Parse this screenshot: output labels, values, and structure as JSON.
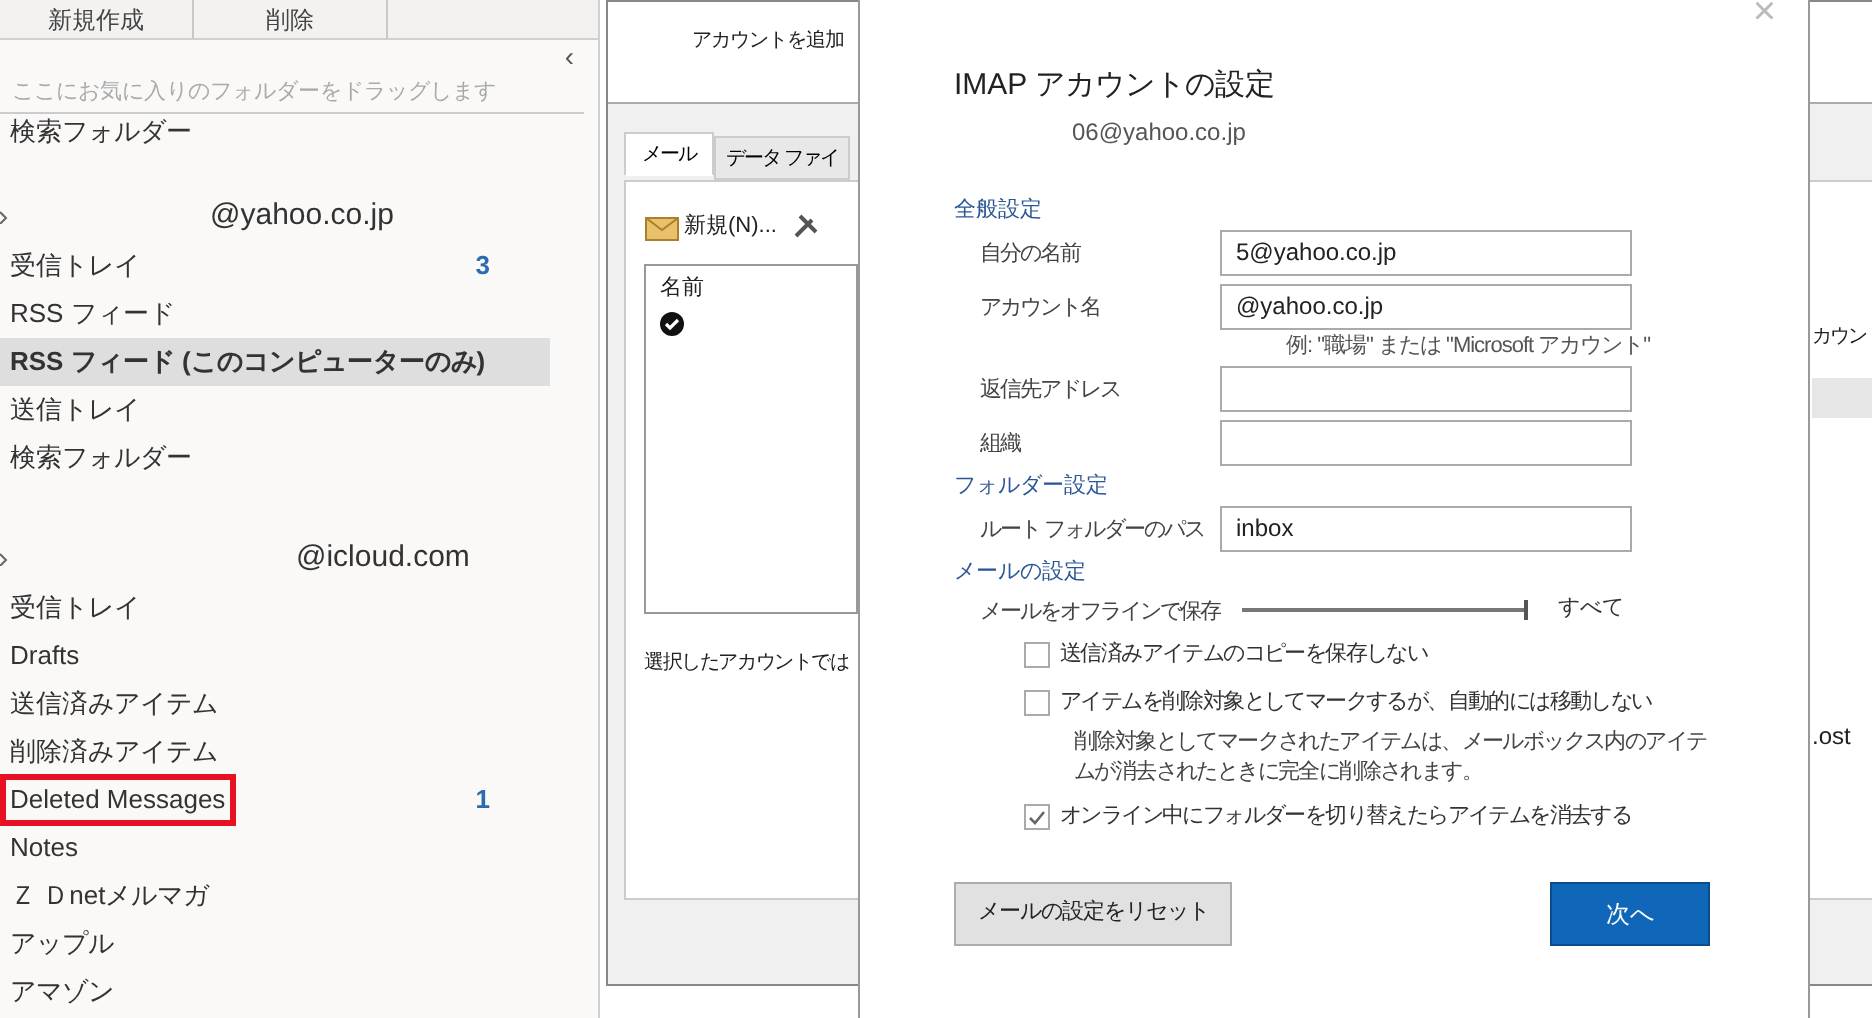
{
  "toolbar": {
    "buttons": [
      "新規作成",
      "削除"
    ]
  },
  "sidebar": {
    "collapse_glyph": "‹",
    "favorites_hint": "ここにお気に入りのフォルダーをドラッグします",
    "top_item": "検索フォルダー",
    "accounts": [
      {
        "name": "@yahoo.co.jp",
        "folders": [
          {
            "label": "受信トレイ",
            "count": "3",
            "selected": false,
            "highlighted": false
          },
          {
            "label": "RSS フィード",
            "selected": false,
            "highlighted": false
          },
          {
            "label": "RSS フィード (このコンピューターのみ)",
            "selected": true,
            "highlighted": false
          },
          {
            "label": "送信トレイ",
            "selected": false,
            "highlighted": false
          },
          {
            "label": "検索フォルダー",
            "selected": false,
            "highlighted": false
          }
        ]
      },
      {
        "name": "@icloud.com",
        "folders": [
          {
            "label": "受信トレイ",
            "selected": false,
            "highlighted": false
          },
          {
            "label": "Drafts",
            "selected": false,
            "highlighted": false
          },
          {
            "label": "送信済みアイテム",
            "selected": false,
            "highlighted": false
          },
          {
            "label": "削除済みアイテム",
            "selected": false,
            "highlighted": false
          },
          {
            "label": "Deleted Messages",
            "count": "1",
            "selected": false,
            "highlighted": true
          },
          {
            "label": "Notes",
            "selected": false,
            "highlighted": false
          },
          {
            "label": "Ｚ Ｄnetメルマガ",
            "selected": false,
            "highlighted": false
          },
          {
            "label": "アップル",
            "selected": false,
            "highlighted": false
          },
          {
            "label": "アマゾン",
            "selected": false,
            "highlighted": false
          }
        ]
      }
    ]
  },
  "account_settings_window": {
    "subtitle": "アカウントを追加",
    "tabs": [
      {
        "label": "メール",
        "selected": true
      },
      {
        "label": "データ ファイ",
        "selected": false
      }
    ],
    "new_button": "新規(N)...",
    "list_header": "名前",
    "note": "選択したアカウントでは",
    "right_texts": [
      "カウン",
      ".ost"
    ]
  },
  "dialog": {
    "close": "×",
    "title": "IMAP アカウントの設定",
    "account": "06@yahoo.co.jp",
    "sections": [
      {
        "heading": "全般設定",
        "fields": [
          {
            "label": "自分の名前",
            "value": "5@yahoo.co.jp"
          },
          {
            "label": "アカウント名",
            "value": "@yahoo.co.jp",
            "hint": "例: \"職場\" または \"Microsoft アカウント\""
          },
          {
            "label": "返信先アドレス"
          },
          {
            "label": "組織"
          }
        ]
      },
      {
        "heading": "フォルダー設定",
        "fields": [
          {
            "label": "ルート フォルダーのパス",
            "value": "inbox"
          }
        ]
      },
      {
        "heading": "メールの設定"
      }
    ],
    "offline": {
      "label": "メールをオフラインで保存",
      "level": 1,
      "reading": "すべて"
    },
    "options": [
      {
        "label": "送信済みアイテムのコピーを保存しない",
        "checked": false
      },
      {
        "label": "アイテムを削除対象としてマークするが、自動的には移動しない",
        "checked": false,
        "note": "削除対象としてマークされたアイテムは、メールボックス内のアイテムが消去されたときに完全に削除されます。"
      },
      {
        "label": "オンライン中にフォルダーを切り替えたらアイテムを消去する",
        "checked": true
      }
    ],
    "reset_button": "メールの設定をリセット",
    "next_button": "次へ"
  }
}
